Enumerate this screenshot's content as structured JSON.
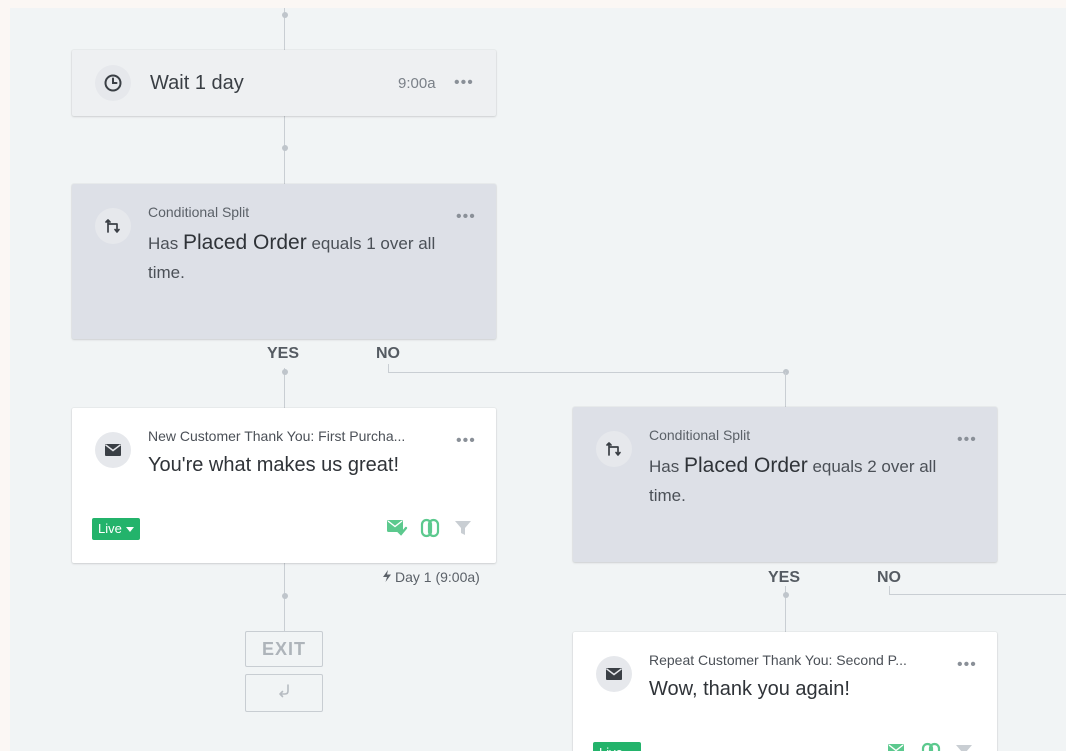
{
  "wait_node": {
    "label": "Wait 1 day",
    "time": "9:00a",
    "more": "•••"
  },
  "split_1": {
    "kind": "Conditional Split",
    "prefix": "Has",
    "metric": "Placed Order",
    "suffix_line1": "equals 1 over all",
    "suffix_line2": "time.",
    "more": "•••",
    "yes_label": "YES",
    "no_label": "NO"
  },
  "email_1": {
    "name": "New Customer Thank You: First Purcha...",
    "subject": "You're what makes us great!",
    "status": "Live",
    "more": "•••",
    "timing": "Day 1 (9:00a)"
  },
  "exit_node": {
    "label": "EXIT"
  },
  "split_2": {
    "kind": "Conditional Split",
    "prefix": "Has",
    "metric": "Placed Order",
    "suffix_line1": "equals 2 over all",
    "suffix_line2": "time.",
    "more": "•••",
    "yes_label": "YES",
    "no_label": "NO"
  },
  "email_2": {
    "name": "Repeat Customer Thank You: Second P...",
    "subject": "Wow, thank you again!",
    "status": "Live",
    "more": "•••"
  },
  "colors": {
    "live_green": "#23b36b",
    "icon_green": "#5cc98e",
    "canvas": "#f1f4f5",
    "split_card": "#dde0e7"
  },
  "icons": [
    "clock-icon",
    "split-icon",
    "envelope-icon",
    "sms-icon",
    "link-icon",
    "filter-icon",
    "bolt-icon",
    "return-icon"
  ]
}
